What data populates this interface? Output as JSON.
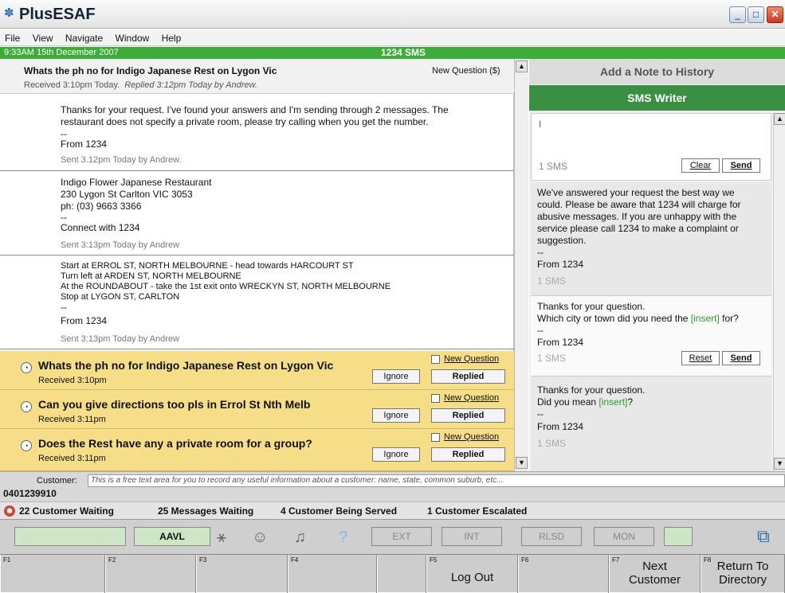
{
  "window": {
    "title": "PlusESAF",
    "icon": "✽"
  },
  "menu": [
    "File",
    "View",
    "Navigate",
    "Window",
    "Help"
  ],
  "greenbar": {
    "datetime": "9:33AM 15th December 2007",
    "service": "1234 SMS"
  },
  "question": {
    "title": "Whats the ph no for Indigo Japanese Rest on Lygon Vic",
    "type": "New Question ($)",
    "received": "Received 3:10pm Today.",
    "replied": "Replied 3:12pm Today by Andrew."
  },
  "messages": [
    {
      "lines": [
        "Thanks for your request. I've found your answers and I'm sending through 2 messages. The",
        "restaurant does not specify a private room, please try calling when you get the number.",
        "--",
        "From 1234"
      ],
      "sent": "Sent 3.12pm Today by Andrew."
    },
    {
      "lines": [
        "Indigo Flower Japanese Restaurant",
        "230 Lygon St Carlton VIC 3053",
        "ph: (03) 9663 3366",
        "--",
        "Connect with 1234"
      ],
      "sent": "Sent 3:13pm Today by Andrew"
    },
    {
      "lines": [
        "Start at ERROL ST, NORTH MELBOURNE - head towards HARCOURT ST",
        "Turn left at ARDEN ST, NORTH MELBOURNE",
        "At the ROUNDABOUT - take the 1st exit onto WRECKYN ST, NORTH MELBOURNE",
        "Stop at LYGON ST, CARLTON",
        "--",
        "From 1234"
      ],
      "sent": "Sent 3:13pm Today by Andrew"
    }
  ],
  "queue": [
    {
      "text": "Whats the ph no for Indigo Japanese Rest on Lygon Vic",
      "received": "Received 3:10pm"
    },
    {
      "text": "Can you give directions too pls in Errol St Nth Melb",
      "received": "Received 3:11pm"
    },
    {
      "text": "Does the Rest have any a private room for a group?",
      "received": "Received 3:11pm"
    }
  ],
  "queue_labels": {
    "new_question": "New Question",
    "ignore": "Ignore",
    "replied": "Replied"
  },
  "right": {
    "note_header": "Add a Note to History",
    "sms_writer": "SMS Writer",
    "cursor": "I",
    "sms_count": "1 SMS",
    "clear": "Clear",
    "send": "Send",
    "reset": "Reset"
  },
  "templates": [
    {
      "lines": [
        "We've answered your request the best way we",
        "could. Please be aware that 1234 will charge for",
        "abusive messages. If you are unhappy with the",
        "service please call 1234 to make a complaint or",
        "suggestion.",
        "--",
        "From 1234"
      ],
      "count": "1 SMS"
    },
    {
      "line1": "Thanks for your question.",
      "line2a": "Which city or town did you need the ",
      "insert": "[insert]",
      "line2b": " for?",
      "dash": "--",
      "from": "From 1234",
      "count": "1 SMS"
    },
    {
      "line1": "Thanks for your question.",
      "line2a": "Did you mean ",
      "insert": "[insert]",
      "line2b": "?",
      "dash": "--",
      "from": "From 1234",
      "count": "1 SMS"
    }
  ],
  "customer": {
    "label": "Customer:",
    "placeholder": "This is a free text area for you to record any useful information about a customer: name, state, common suburb, etc...",
    "phone": "0401239910"
  },
  "status": {
    "waiting_customers": "22 Customer Waiting",
    "waiting_messages": "25 Messages Waiting",
    "being_served": "4 Customer Being Served",
    "escalated": "1 Customer Escalated"
  },
  "toolbar": {
    "aavl": "AAVL",
    "ext": "EXT",
    "int": "INT",
    "rlsd": "RLSD",
    "mon": "MON"
  },
  "fkeys": [
    {
      "num": "F1",
      "label": ""
    },
    {
      "num": "F2",
      "label": ""
    },
    {
      "num": "F3",
      "label": ""
    },
    {
      "num": "F4",
      "label": ""
    },
    {
      "num": "",
      "label": ""
    },
    {
      "num": "F5",
      "label": "Log Out"
    },
    {
      "num": "F6",
      "label": ""
    },
    {
      "num": "F7",
      "label": "Next Customer"
    },
    {
      "num": "F8",
      "label": "Return To Directory"
    }
  ]
}
